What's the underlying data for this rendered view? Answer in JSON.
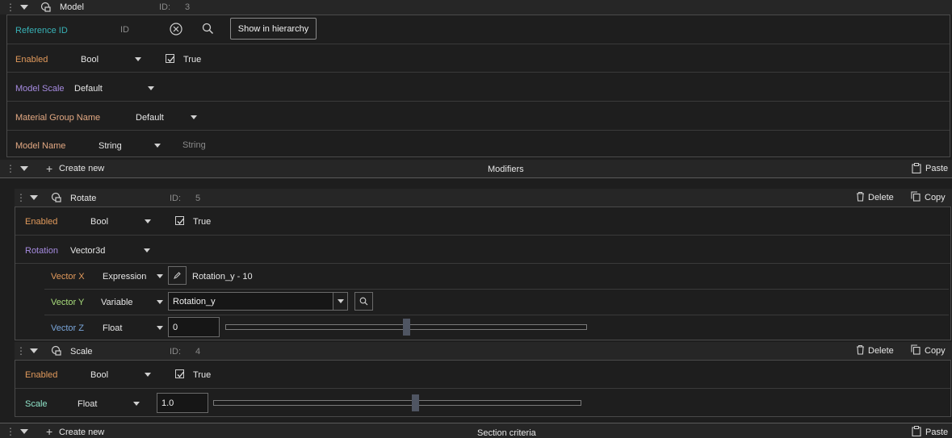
{
  "model": {
    "title": "Model",
    "id_label": "ID:",
    "id_value": "3",
    "reference": {
      "label": "Reference ID",
      "placeholder": "ID",
      "show_hierarchy_label": "Show in hierarchy"
    },
    "enabled": {
      "label": "Enabled",
      "type": "Bool",
      "value": "True"
    },
    "model_scale": {
      "label": "Model Scale",
      "value": "Default"
    },
    "material_group": {
      "label": "Material Group Name",
      "value": "Default"
    },
    "model_name": {
      "label": "Model Name",
      "type": "String",
      "placeholder": "String"
    }
  },
  "modifiers_bar": {
    "create_label": "Create new",
    "title": "Modifiers",
    "paste_label": "Paste"
  },
  "rotate": {
    "title": "Rotate",
    "id_label": "ID:",
    "id_value": "5",
    "delete_label": "Delete",
    "copy_label": "Copy",
    "enabled": {
      "label": "Enabled",
      "type": "Bool",
      "value": "True"
    },
    "rotation": {
      "label": "Rotation",
      "type": "Vector3d"
    },
    "vector_x": {
      "label": "Vector X",
      "type": "Expression",
      "value": "Rotation_y - 10"
    },
    "vector_y": {
      "label": "Vector Y",
      "type": "Variable",
      "value": "Rotation_y"
    },
    "vector_z": {
      "label": "Vector Z",
      "type": "Float",
      "value": "0",
      "slider_fraction": 0.5
    }
  },
  "scale": {
    "title": "Scale",
    "id_label": "ID:",
    "id_value": "4",
    "delete_label": "Delete",
    "copy_label": "Copy",
    "enabled": {
      "label": "Enabled",
      "type": "Bool",
      "value": "True"
    },
    "scale_field": {
      "label": "Scale",
      "type": "Float",
      "value": "1.0",
      "slider_fraction": 0.55
    }
  },
  "criteria_bar": {
    "create_label": "Create new",
    "title": "Section criteria",
    "paste_label": "Paste"
  },
  "colors": {
    "background": "#1e1e1e",
    "reference_label": "#38b2b6",
    "enabled_label": "#e29a5c",
    "scale_label": "#a68be0",
    "vector_y_label": "#a9dd7c",
    "vector_z_label": "#7aa6da"
  }
}
